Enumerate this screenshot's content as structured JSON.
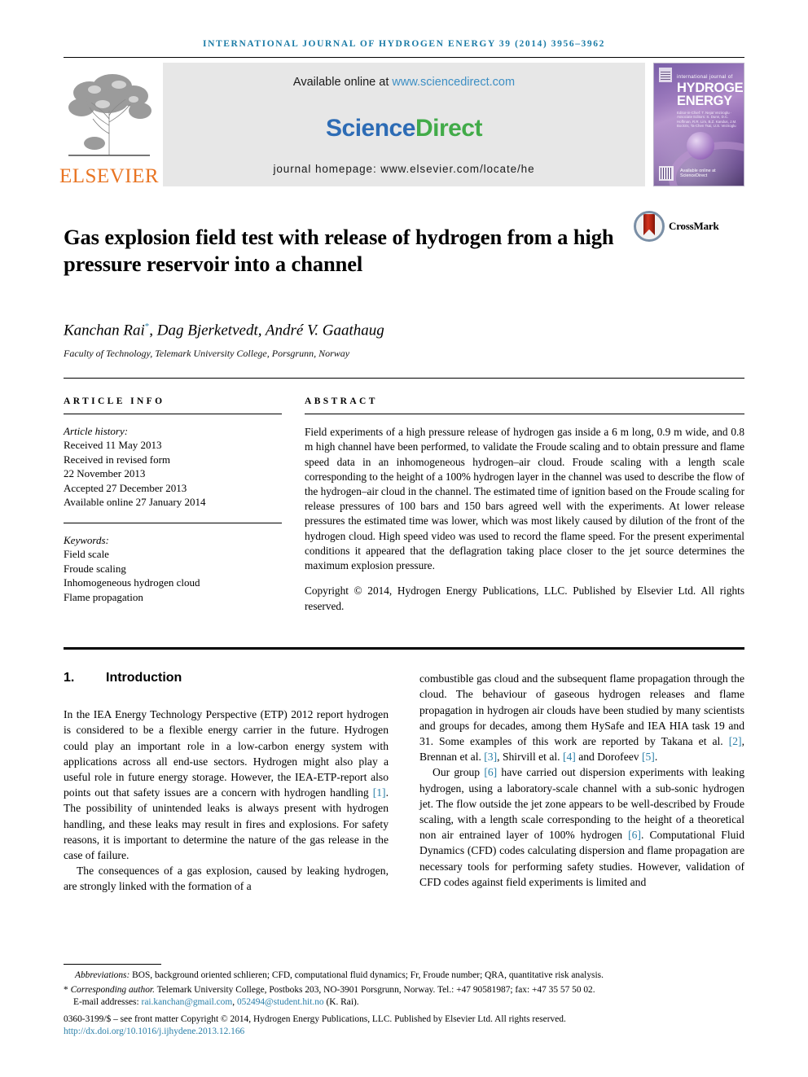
{
  "running_head": "International Journal of Hydrogen Energy 39 (2014) 3956–3962",
  "masthead": {
    "elsevier_wordmark": "ELSEVIER",
    "available_prefix": "Available online at ",
    "available_url": "www.sciencedirect.com",
    "sciencedirect_part1": "Science",
    "sciencedirect_part2": "Direct",
    "journal_homepage": "journal homepage: www.elsevier.com/locate/he",
    "cover": {
      "kicker": "international journal of",
      "line1": "HYDROGEN",
      "line2": "ENERGY",
      "editors": "Editor-in-Chief: T. Nejat Veziroglu · Associate Editors: S. Dunn, D.C. Hoffman, R.R. Lim, B.Z. Kandus, J.M. Bockris, Ta-Chen Tsai, U.S. Veziroglu",
      "sciencedirect_mark": "Available online at ScienceDirect"
    }
  },
  "article": {
    "title": "Gas explosion field test with release of hydrogen from a high pressure reservoir into a channel",
    "crossmark_label": "CrossMark",
    "authors": "Kanchan Rai",
    "authors_star": "*",
    "authors_rest": ", Dag Bjerketvedt, André V. Gaathaug",
    "affiliation": "Faculty of Technology, Telemark University College, Porsgrunn, Norway"
  },
  "article_info": {
    "heading": "Article info",
    "history_label": "Article history:",
    "history": [
      "Received 11 May 2013",
      "Received in revised form",
      "22 November 2013",
      "Accepted 27 December 2013",
      "Available online 27 January 2014"
    ],
    "keywords_label": "Keywords:",
    "keywords": [
      "Field scale",
      "Froude scaling",
      "Inhomogeneous hydrogen cloud",
      "Flame propagation"
    ]
  },
  "abstract": {
    "heading": "Abstract",
    "text": "Field experiments of a high pressure release of hydrogen gas inside a 6 m long, 0.9 m wide, and 0.8 m high channel have been performed, to validate the Froude scaling and to obtain pressure and flame speed data in an inhomogeneous hydrogen–air cloud. Froude scaling with a length scale corresponding to the height of a 100% hydrogen layer in the channel was used to describe the flow of the hydrogen–air cloud in the channel. The estimated time of ignition based on the Froude scaling for release pressures of 100 bars and 150 bars agreed well with the experiments. At lower release pressures the estimated time was lower, which was most likely caused by dilution of the front of the hydrogen cloud. High speed video was used to record the flame speed. For the present experimental conditions it appeared that the deflagration taking place closer to the jet source determines the maximum explosion pressure.",
    "copyright": "Copyright © 2014, Hydrogen Energy Publications, LLC. Published by Elsevier Ltd. All rights reserved."
  },
  "section": {
    "number": "1.",
    "title": "Introduction"
  },
  "body": {
    "left": [
      "In the IEA Energy Technology Perspective (ETP) 2012 report hydrogen is considered to be a flexible energy carrier in the future. Hydrogen could play an important role in a low-carbon energy system with applications across all end-use sectors. Hydrogen might also play a useful role in future energy storage. However, the IEA-ETP-report also points out that safety issues are a concern with hydrogen handling [1]. The possibility of unintended leaks is always present with hydrogen handling, and these leaks may result in fires and explosions. For safety reasons, it is important to determine the nature of the gas release in the case of failure.",
      "The consequences of a gas explosion, caused by leaking hydrogen, are strongly linked with the formation of a"
    ],
    "right": [
      "combustible gas cloud and the subsequent flame propagation through the cloud. The behaviour of gaseous hydrogen releases and flame propagation in hydrogen air clouds have been studied by many scientists and groups for decades, among them HySafe and IEA HIA task 19 and 31. Some examples of this work are reported by Takana et al. [2], Brennan et al. [3], Shirvill et al. [4] and Dorofeev [5].",
      "Our group [6] have carried out dispersion experiments with leaking hydrogen, using a laboratory-scale channel with a sub-sonic hydrogen jet. The flow outside the jet zone appears to be well-described by Froude scaling, with a length scale corresponding to the height of a theoretical non air entrained layer of 100% hydrogen [6]. Computational Fluid Dynamics (CFD) codes calculating dispersion and flame propagation are necessary tools for performing safety studies. However, validation of CFD codes against field experiments is limited and"
    ]
  },
  "footnotes": {
    "abbreviations_label": "Abbreviations:",
    "abbreviations_text": " BOS, background oriented schlieren; CFD, computational fluid dynamics; Fr, Froude number; QRA, quantitative risk analysis.",
    "corresponding_star": "*",
    "corresponding_label": "Corresponding author.",
    "corresponding_text": " Telemark University College, Postboks 203, NO-3901 Porsgrunn, Norway. Tel.: +47 90581987; fax: +47 35 57 50 02.",
    "email_label": "E-mail addresses:",
    "email1": "rai.kanchan@gmail.com",
    "email2": "052494@student.hit.no",
    "email_suffix": " (K. Rai).",
    "issn_line": "0360-3199/$ – see front matter Copyright © 2014, Hydrogen Energy Publications, LLC. Published by Elsevier Ltd. All rights reserved.",
    "doi": "http://dx.doi.org/10.1016/j.ijhydene.2013.12.166"
  },
  "colors": {
    "link": "#2a7fa8",
    "elsevier_orange": "#e87422",
    "sciencedirect_blue": "#2d6cb5",
    "sciencedirect_green": "#42ab49",
    "running_head": "#1b7ba6"
  }
}
